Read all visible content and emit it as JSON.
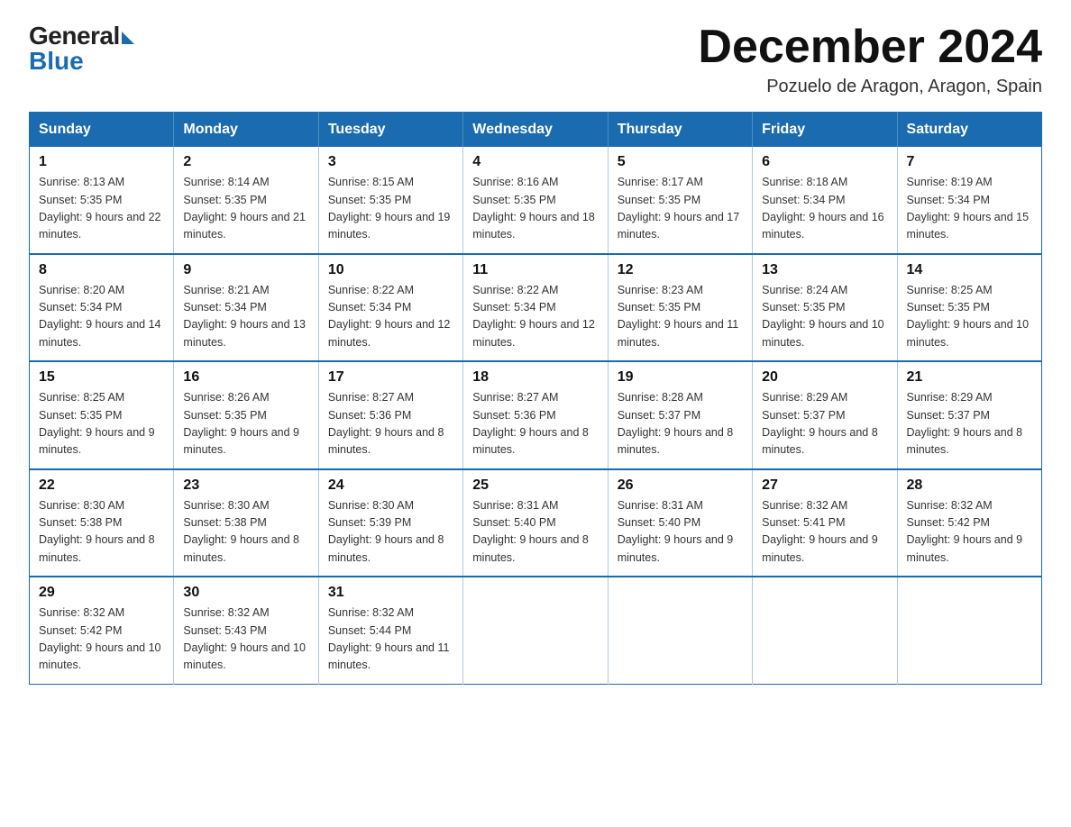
{
  "logo": {
    "general": "General",
    "blue": "Blue"
  },
  "title": "December 2024",
  "subtitle": "Pozuelo de Aragon, Aragon, Spain",
  "days_of_week": [
    "Sunday",
    "Monday",
    "Tuesday",
    "Wednesday",
    "Thursday",
    "Friday",
    "Saturday"
  ],
  "weeks": [
    [
      {
        "day": "1",
        "sunrise": "8:13 AM",
        "sunset": "5:35 PM",
        "daylight": "9 hours and 22 minutes."
      },
      {
        "day": "2",
        "sunrise": "8:14 AM",
        "sunset": "5:35 PM",
        "daylight": "9 hours and 21 minutes."
      },
      {
        "day": "3",
        "sunrise": "8:15 AM",
        "sunset": "5:35 PM",
        "daylight": "9 hours and 19 minutes."
      },
      {
        "day": "4",
        "sunrise": "8:16 AM",
        "sunset": "5:35 PM",
        "daylight": "9 hours and 18 minutes."
      },
      {
        "day": "5",
        "sunrise": "8:17 AM",
        "sunset": "5:35 PM",
        "daylight": "9 hours and 17 minutes."
      },
      {
        "day": "6",
        "sunrise": "8:18 AM",
        "sunset": "5:34 PM",
        "daylight": "9 hours and 16 minutes."
      },
      {
        "day": "7",
        "sunrise": "8:19 AM",
        "sunset": "5:34 PM",
        "daylight": "9 hours and 15 minutes."
      }
    ],
    [
      {
        "day": "8",
        "sunrise": "8:20 AM",
        "sunset": "5:34 PM",
        "daylight": "9 hours and 14 minutes."
      },
      {
        "day": "9",
        "sunrise": "8:21 AM",
        "sunset": "5:34 PM",
        "daylight": "9 hours and 13 minutes."
      },
      {
        "day": "10",
        "sunrise": "8:22 AM",
        "sunset": "5:34 PM",
        "daylight": "9 hours and 12 minutes."
      },
      {
        "day": "11",
        "sunrise": "8:22 AM",
        "sunset": "5:34 PM",
        "daylight": "9 hours and 12 minutes."
      },
      {
        "day": "12",
        "sunrise": "8:23 AM",
        "sunset": "5:35 PM",
        "daylight": "9 hours and 11 minutes."
      },
      {
        "day": "13",
        "sunrise": "8:24 AM",
        "sunset": "5:35 PM",
        "daylight": "9 hours and 10 minutes."
      },
      {
        "day": "14",
        "sunrise": "8:25 AM",
        "sunset": "5:35 PM",
        "daylight": "9 hours and 10 minutes."
      }
    ],
    [
      {
        "day": "15",
        "sunrise": "8:25 AM",
        "sunset": "5:35 PM",
        "daylight": "9 hours and 9 minutes."
      },
      {
        "day": "16",
        "sunrise": "8:26 AM",
        "sunset": "5:35 PM",
        "daylight": "9 hours and 9 minutes."
      },
      {
        "day": "17",
        "sunrise": "8:27 AM",
        "sunset": "5:36 PM",
        "daylight": "9 hours and 8 minutes."
      },
      {
        "day": "18",
        "sunrise": "8:27 AM",
        "sunset": "5:36 PM",
        "daylight": "9 hours and 8 minutes."
      },
      {
        "day": "19",
        "sunrise": "8:28 AM",
        "sunset": "5:37 PM",
        "daylight": "9 hours and 8 minutes."
      },
      {
        "day": "20",
        "sunrise": "8:29 AM",
        "sunset": "5:37 PM",
        "daylight": "9 hours and 8 minutes."
      },
      {
        "day": "21",
        "sunrise": "8:29 AM",
        "sunset": "5:37 PM",
        "daylight": "9 hours and 8 minutes."
      }
    ],
    [
      {
        "day": "22",
        "sunrise": "8:30 AM",
        "sunset": "5:38 PM",
        "daylight": "9 hours and 8 minutes."
      },
      {
        "day": "23",
        "sunrise": "8:30 AM",
        "sunset": "5:38 PM",
        "daylight": "9 hours and 8 minutes."
      },
      {
        "day": "24",
        "sunrise": "8:30 AM",
        "sunset": "5:39 PM",
        "daylight": "9 hours and 8 minutes."
      },
      {
        "day": "25",
        "sunrise": "8:31 AM",
        "sunset": "5:40 PM",
        "daylight": "9 hours and 8 minutes."
      },
      {
        "day": "26",
        "sunrise": "8:31 AM",
        "sunset": "5:40 PM",
        "daylight": "9 hours and 9 minutes."
      },
      {
        "day": "27",
        "sunrise": "8:32 AM",
        "sunset": "5:41 PM",
        "daylight": "9 hours and 9 minutes."
      },
      {
        "day": "28",
        "sunrise": "8:32 AM",
        "sunset": "5:42 PM",
        "daylight": "9 hours and 9 minutes."
      }
    ],
    [
      {
        "day": "29",
        "sunrise": "8:32 AM",
        "sunset": "5:42 PM",
        "daylight": "9 hours and 10 minutes."
      },
      {
        "day": "30",
        "sunrise": "8:32 AM",
        "sunset": "5:43 PM",
        "daylight": "9 hours and 10 minutes."
      },
      {
        "day": "31",
        "sunrise": "8:32 AM",
        "sunset": "5:44 PM",
        "daylight": "9 hours and 11 minutes."
      },
      null,
      null,
      null,
      null
    ]
  ]
}
